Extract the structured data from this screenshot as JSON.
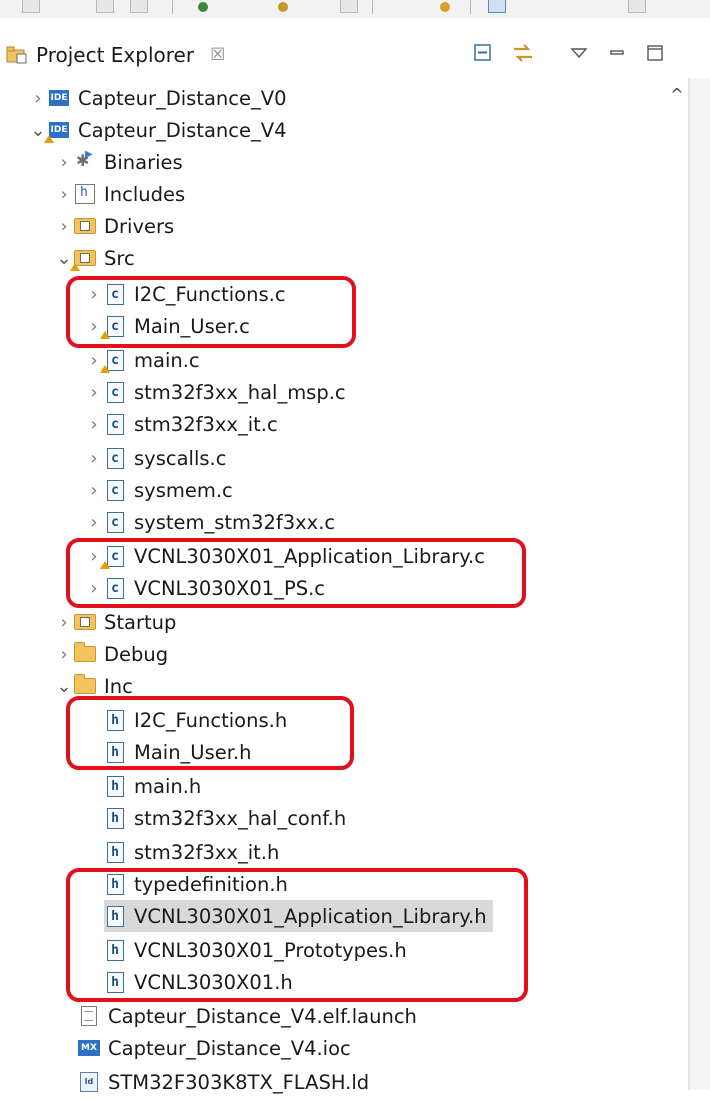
{
  "view": {
    "title": "Project Explorer",
    "close_glyph": "☒"
  },
  "tree": [
    {
      "label": "Capteur_Distance_V0",
      "icon": "ide-project-icon",
      "expanded": false
    },
    {
      "label": "Capteur_Distance_V4",
      "icon": "ide-project-icon",
      "expanded": true,
      "warning": true
    },
    {
      "label": "Binaries",
      "icon": "binaries-icon",
      "expanded": false
    },
    {
      "label": "Includes",
      "icon": "includes-icon",
      "expanded": false
    },
    {
      "label": "Drivers",
      "icon": "source-folder-icon",
      "expanded": false
    },
    {
      "label": "Src",
      "icon": "source-folder-icon",
      "expanded": true,
      "warning": true
    },
    {
      "label": "I2C_Functions.c",
      "icon": "c-file-icon",
      "expanded": false
    },
    {
      "label": "Main_User.c",
      "icon": "c-file-icon",
      "expanded": false,
      "warning": true
    },
    {
      "label": "main.c",
      "icon": "c-file-icon",
      "expanded": false,
      "warning": true
    },
    {
      "label": "stm32f3xx_hal_msp.c",
      "icon": "c-file-icon",
      "expanded": false
    },
    {
      "label": "stm32f3xx_it.c",
      "icon": "c-file-icon",
      "expanded": false
    },
    {
      "label": "syscalls.c",
      "icon": "c-file-icon",
      "expanded": false
    },
    {
      "label": "sysmem.c",
      "icon": "c-file-icon",
      "expanded": false
    },
    {
      "label": "system_stm32f3xx.c",
      "icon": "c-file-icon",
      "expanded": false
    },
    {
      "label": "VCNL3030X01_Application_Library.c",
      "icon": "c-file-icon",
      "expanded": false,
      "warning": true
    },
    {
      "label": "VCNL3030X01_PS.c",
      "icon": "c-file-icon",
      "expanded": false
    },
    {
      "label": "Startup",
      "icon": "source-folder-icon",
      "expanded": false
    },
    {
      "label": "Debug",
      "icon": "folder-icon",
      "expanded": false
    },
    {
      "label": "Inc",
      "icon": "folder-icon",
      "expanded": true
    },
    {
      "label": "I2C_Functions.h",
      "icon": "h-file-icon"
    },
    {
      "label": "Main_User.h",
      "icon": "h-file-icon"
    },
    {
      "label": "main.h",
      "icon": "h-file-icon"
    },
    {
      "label": "stm32f3xx_hal_conf.h",
      "icon": "h-file-icon"
    },
    {
      "label": "stm32f3xx_it.h",
      "icon": "h-file-icon"
    },
    {
      "label": "typedefinition.h",
      "icon": "h-file-icon"
    },
    {
      "label": "VCNL3030X01_Application_Library.h",
      "icon": "h-file-icon",
      "selected": true
    },
    {
      "label": "VCNL3030X01_Prototypes.h",
      "icon": "h-file-icon"
    },
    {
      "label": "VCNL3030X01.h",
      "icon": "h-file-icon"
    },
    {
      "label": "Capteur_Distance_V4.elf.launch",
      "icon": "launch-file-icon"
    },
    {
      "label": "Capteur_Distance_V4.ioc",
      "icon": "mx-file-icon"
    },
    {
      "label": "STM32F303K8TX_FLASH.ld",
      "icon": "ld-file-icon"
    }
  ],
  "icon_glyphs": {
    "ide": "IDE",
    "c": "c",
    "h": "h",
    "mx": "MX",
    "ld": "ld"
  },
  "colors": {
    "highlight_box": "#e0111b",
    "selection": "#d9d9d9"
  }
}
